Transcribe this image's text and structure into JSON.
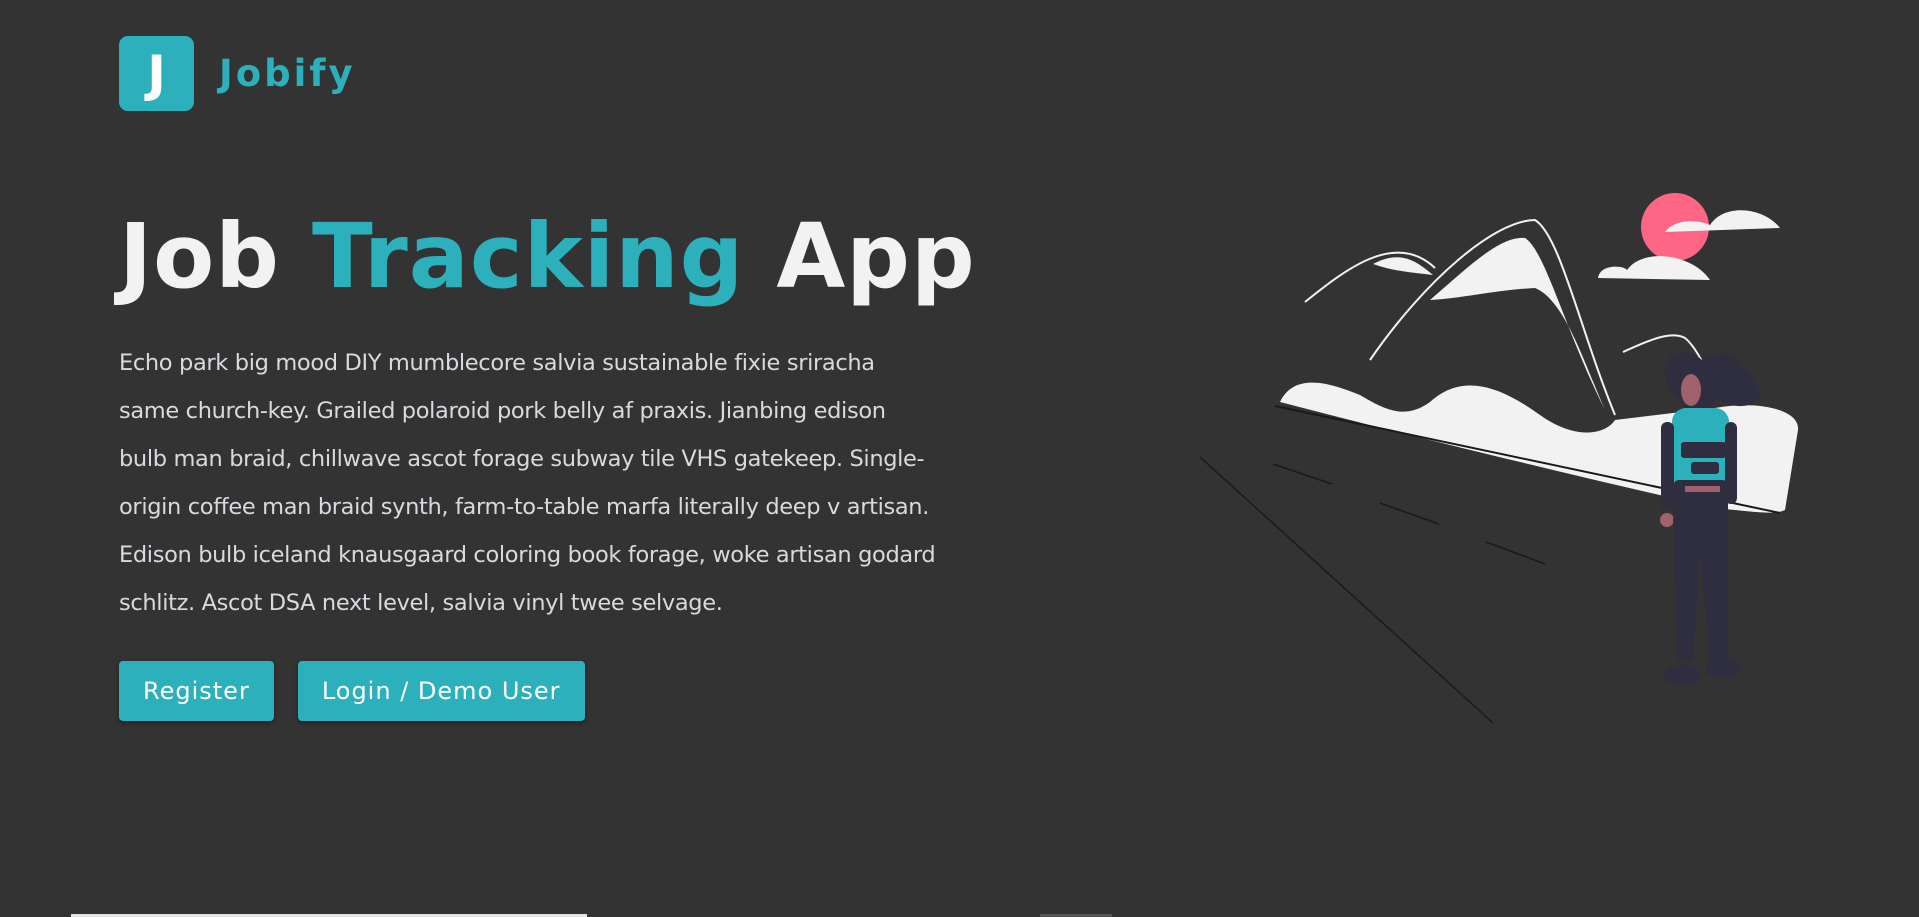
{
  "brand": {
    "logo_letter": "J",
    "name": "Jobify",
    "accent_color": "#2cb1bc"
  },
  "hero": {
    "title_prefix": "Job",
    "title_accent": "Tracking",
    "title_suffix": "App",
    "description": "Echo park big mood DIY mumblecore salvia sustainable fixie sriracha same church-key. Grailed polaroid pork belly af praxis. Jianbing edison bulb man braid, chillwave ascot forage subway tile VHS gatekeep. Single-origin coffee man braid synth, farm-to-table marfa literally deep v artisan. Edison bulb iceland knausgaard coloring book forage, woke artisan godard schlitz. Ascot DSA next level, salvia vinyl twee selvage."
  },
  "actions": {
    "register_label": "Register",
    "login_label": "Login / Demo User"
  },
  "illustration": {
    "icon": "traveler-mountains-illustration",
    "sun_color": "#ff6584",
    "backpack_color": "#2cb1bc"
  }
}
